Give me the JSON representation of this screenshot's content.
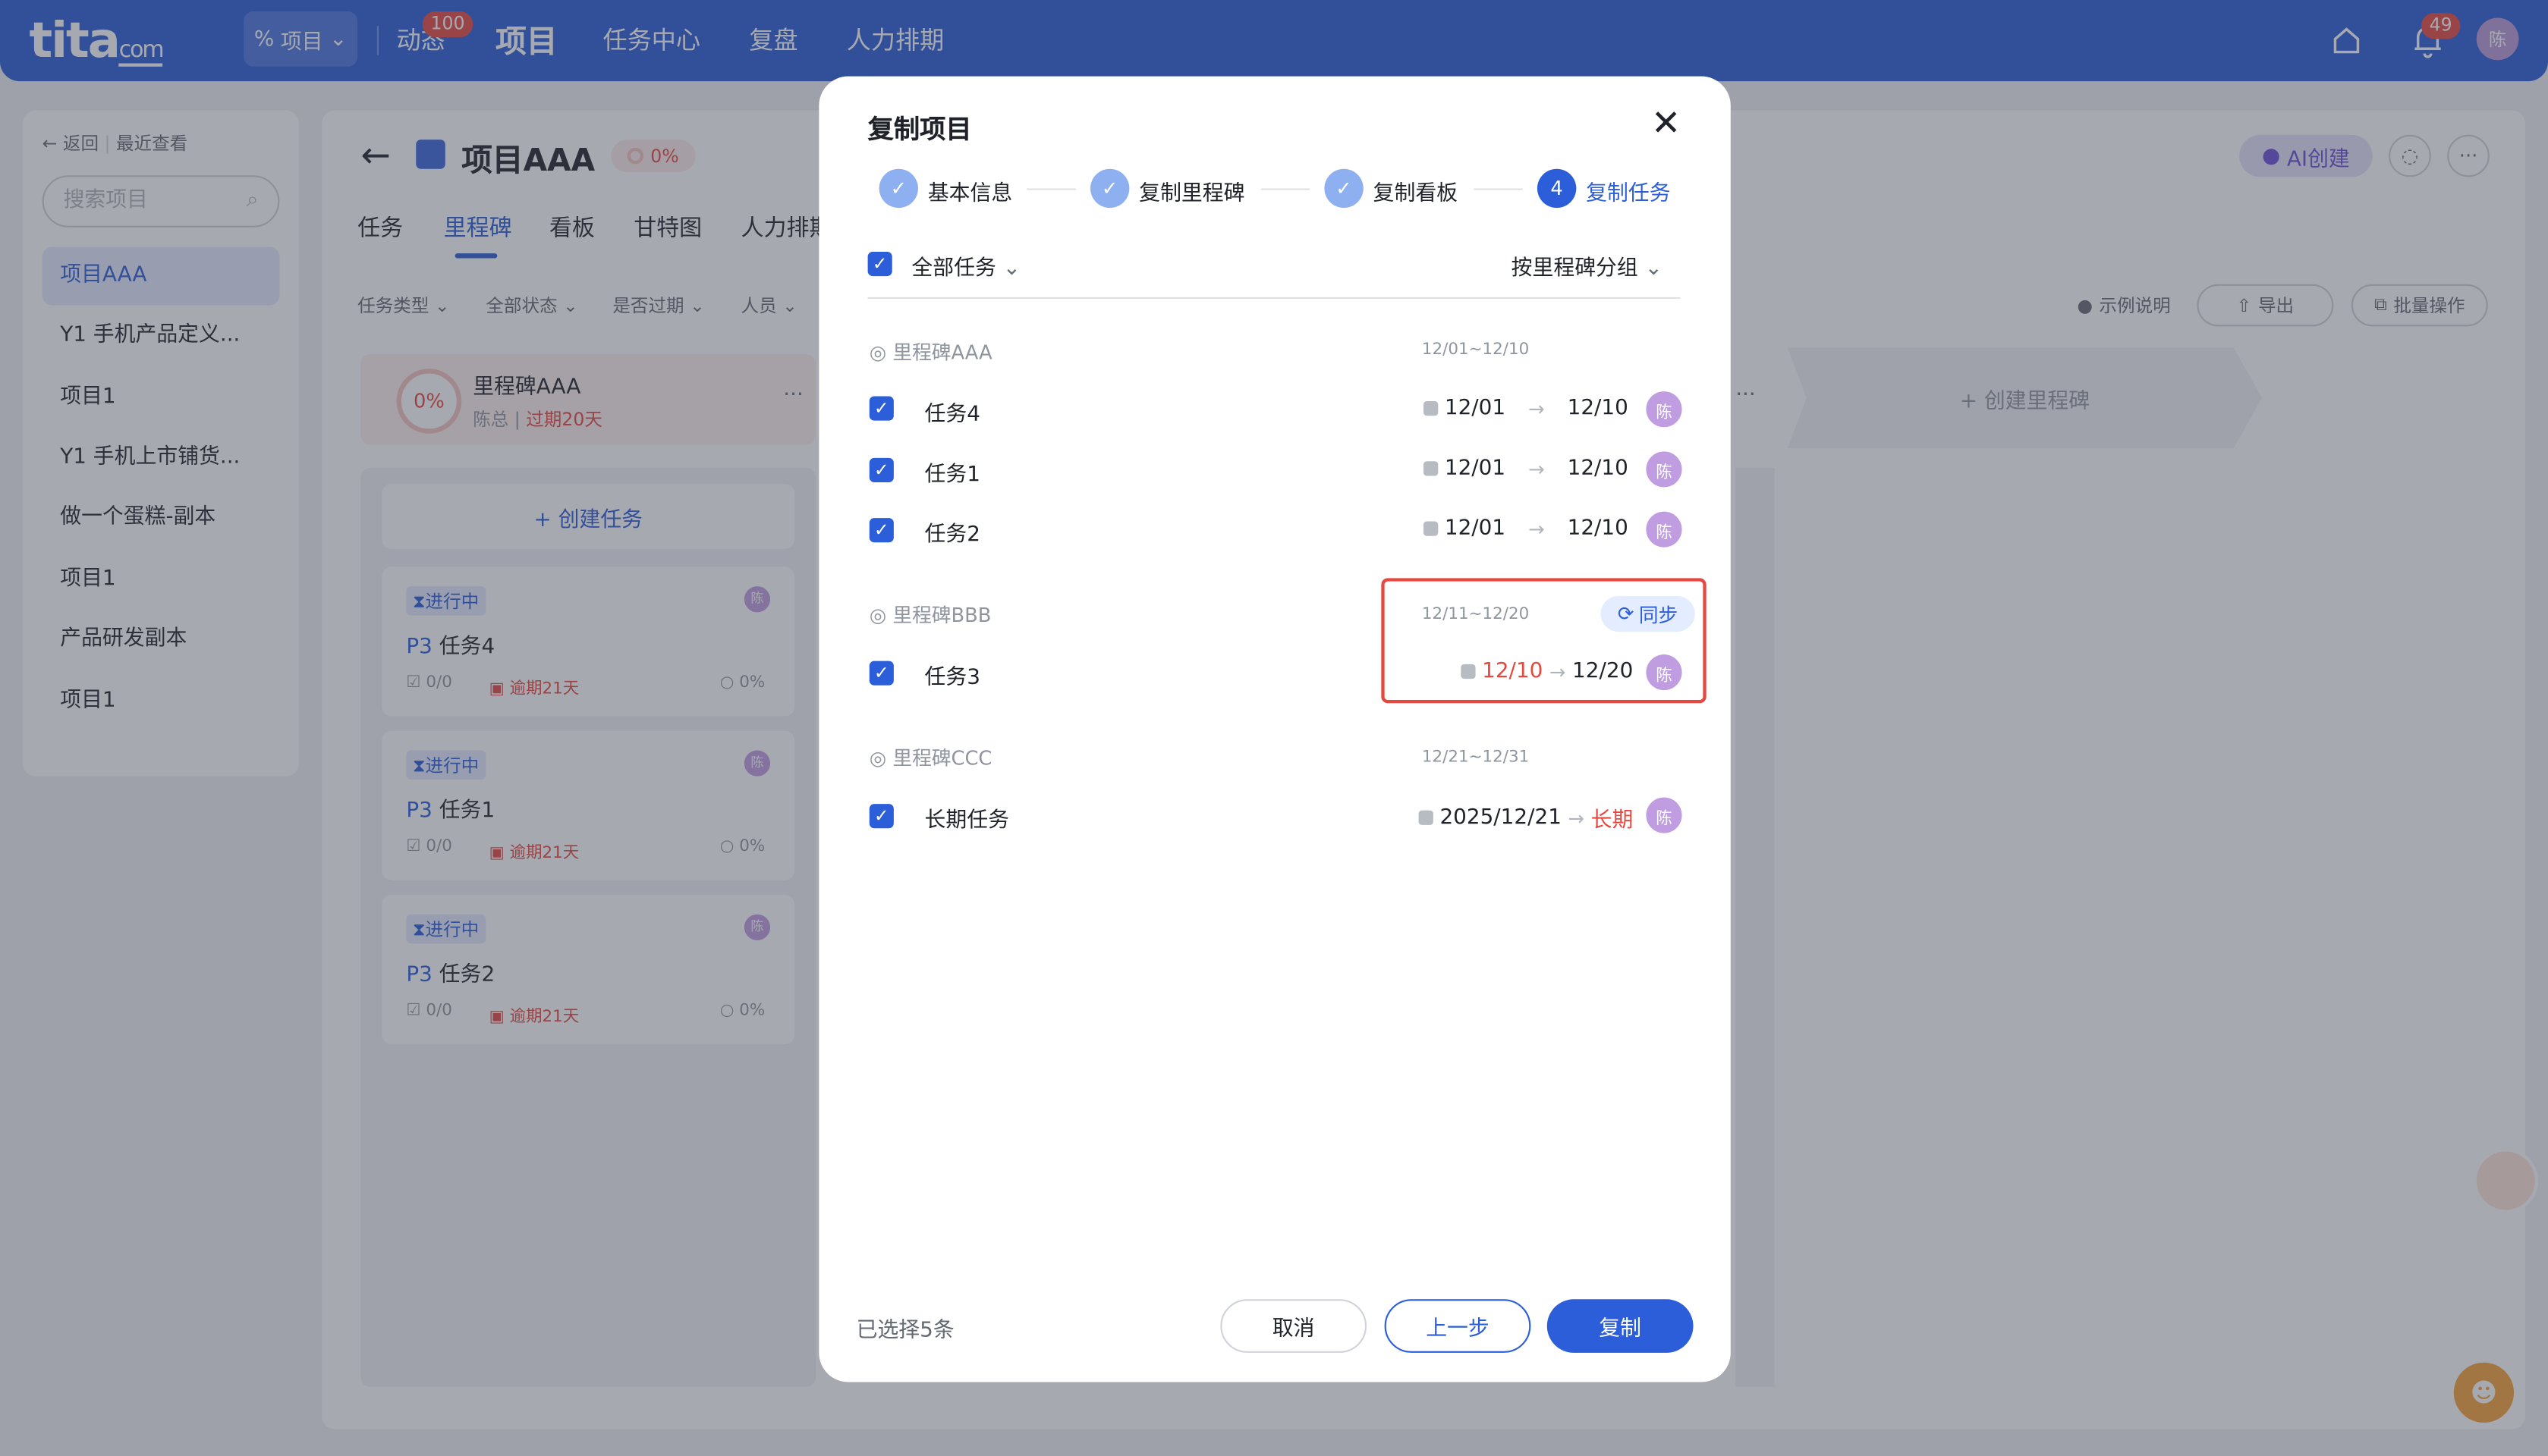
{
  "topbar": {
    "logo": "tita",
    "logo_suffix": "com",
    "project_selector": "项目",
    "nav": [
      {
        "label": "动态",
        "badge": "100"
      },
      {
        "label": "项目"
      },
      {
        "label": "任务中心"
      },
      {
        "label": "复盘"
      },
      {
        "label": "人力排期"
      }
    ],
    "notification_badge": "49",
    "avatar": "陈"
  },
  "sidebar": {
    "back": "返回",
    "recent": "最近查看",
    "search_placeholder": "搜索项目",
    "items": [
      {
        "label": "项目AAA",
        "active": true
      },
      {
        "label": "Y1 手机产品定义..."
      },
      {
        "label": "项目1"
      },
      {
        "label": "Y1 手机上市铺货..."
      },
      {
        "label": "做一个蛋糕-副本"
      },
      {
        "label": "项目1"
      },
      {
        "label": "产品研发副本"
      },
      {
        "label": "项目1"
      }
    ]
  },
  "main": {
    "title": "项目AAA",
    "progress": "0%",
    "tabs": [
      "任务",
      "里程碑",
      "看板",
      "甘特图",
      "人力排期"
    ],
    "active_tab": "里程碑",
    "filters": [
      "任务类型",
      "全部状态",
      "是否过期",
      "人员"
    ],
    "ai_button": "AI创建",
    "tools": [
      "示例说明",
      "导出",
      "批量操作"
    ],
    "milestone": {
      "name": "里程碑AAA",
      "progress": "0%",
      "owner": "陈总",
      "overdue": "过期20天"
    },
    "create_task": "+ 创建任务",
    "create_milestone": "+ 创建里程碑",
    "task_cards": [
      {
        "status": "进行中",
        "priority": "P3",
        "name": "任务4",
        "sub": "0/0",
        "overdue": "逾期21天",
        "pct": "0%",
        "avatar": "陈"
      },
      {
        "status": "进行中",
        "priority": "P3",
        "name": "任务1",
        "sub": "0/0",
        "overdue": "逾期21天",
        "pct": "0%",
        "avatar": "陈"
      },
      {
        "status": "进行中",
        "priority": "P3",
        "name": "任务2",
        "sub": "0/0",
        "overdue": "逾期21天",
        "pct": "0%",
        "avatar": "陈"
      }
    ]
  },
  "modal": {
    "title": "复制项目",
    "steps": [
      {
        "label": "基本信息",
        "done": true
      },
      {
        "label": "复制里程碑",
        "done": true
      },
      {
        "label": "复制看板",
        "done": true
      },
      {
        "label": "复制任务",
        "number": "4",
        "current": true
      }
    ],
    "all_tasks": "全部任务",
    "group_by": "按里程碑分组",
    "groups": [
      {
        "milestone": "里程碑AAA",
        "range": "12/01~12/10",
        "tasks": [
          {
            "name": "任务4",
            "start": "12/01",
            "end": "12/10",
            "avatar": "陈"
          },
          {
            "name": "任务1",
            "start": "12/01",
            "end": "12/10",
            "avatar": "陈"
          },
          {
            "name": "任务2",
            "start": "12/01",
            "end": "12/10",
            "avatar": "陈"
          }
        ]
      },
      {
        "milestone": "里程碑BBB",
        "range": "12/11~12/20",
        "sync": "同步",
        "tasks": [
          {
            "name": "任务3",
            "start": "12/10",
            "end": "12/20",
            "avatar": "陈",
            "start_warning": true
          }
        ]
      },
      {
        "milestone": "里程碑CCC",
        "range": "12/21~12/31",
        "tasks": [
          {
            "name": "长期任务",
            "start": "2025/12/21",
            "end": "长期",
            "avatar": "陈",
            "end_warning": true
          }
        ]
      }
    ],
    "selected": "已选择5条",
    "buttons": {
      "cancel": "取消",
      "prev": "上一步",
      "copy": "复制"
    }
  },
  "colors": {
    "primary": "#2b5ed8",
    "danger": "#e5483e",
    "avatar": "#c09ce0"
  }
}
